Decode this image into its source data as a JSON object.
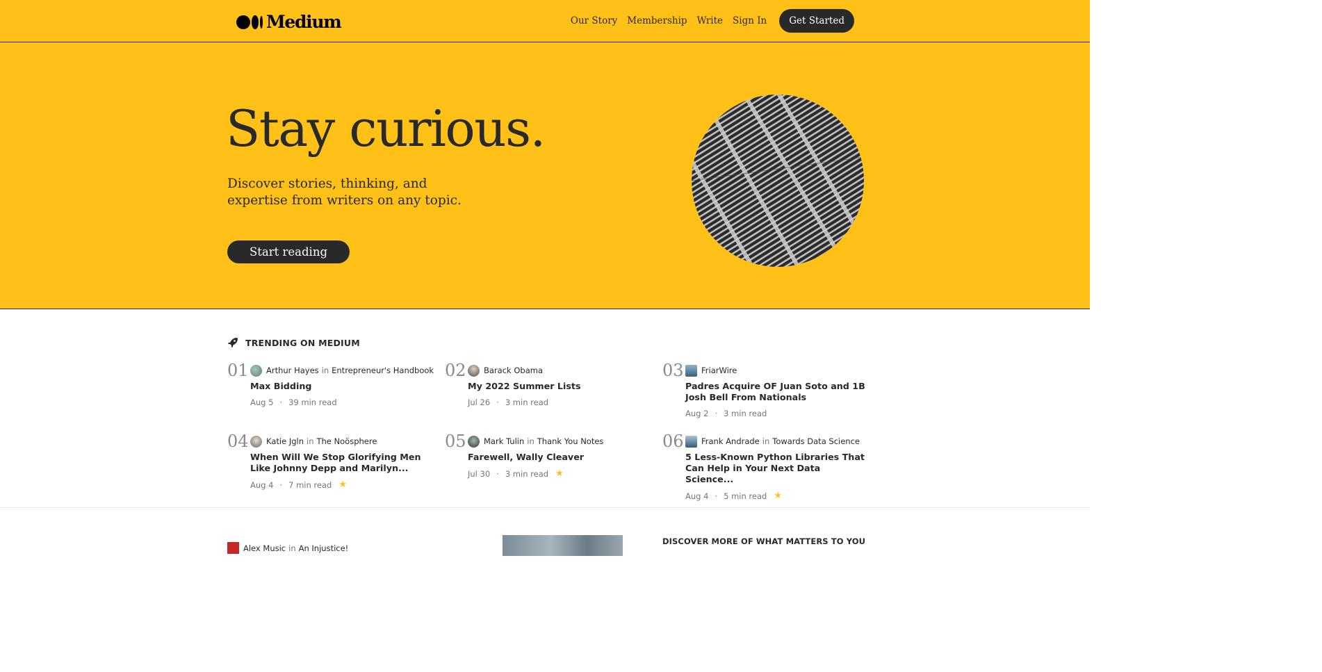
{
  "header": {
    "logo_text": "Medium",
    "nav": [
      "Our Story",
      "Membership",
      "Write",
      "Sign In"
    ],
    "cta_label": "Get Started"
  },
  "hero": {
    "title": "Stay curious.",
    "subtitle": "Discover stories, thinking, and expertise from writers on any topic.",
    "cta_label": "Start reading"
  },
  "trending": {
    "heading": "TRENDING ON MEDIUM",
    "in_word": "in",
    "items": [
      {
        "num": "01",
        "author": "Arthur Hayes",
        "publication": "Entrepreneur's Handbook",
        "title": "Max Bidding",
        "date": "Aug 5",
        "read": "39 min read",
        "starred": false
      },
      {
        "num": "02",
        "author": "Barack Obama",
        "publication": "",
        "title": "My 2022 Summer Lists",
        "date": "Jul 26",
        "read": "3 min read",
        "starred": false
      },
      {
        "num": "03",
        "author": "FriarWire",
        "publication": "",
        "title": "Padres Acquire OF Juan Soto and 1B Josh Bell From Nationals",
        "date": "Aug 2",
        "read": "3 min read",
        "starred": false
      },
      {
        "num": "04",
        "author": "Katie Jgln",
        "publication": "The Noösphere",
        "title": "When Will We Stop Glorifying Men Like Johnny Depp and Marilyn...",
        "date": "Aug 4",
        "read": "7 min read",
        "starred": true
      },
      {
        "num": "05",
        "author": "Mark Tulin",
        "publication": "Thank You Notes",
        "title": "Farewell, Wally Cleaver",
        "date": "Jul 30",
        "read": "3 min read",
        "starred": true
      },
      {
        "num": "06",
        "author": "Frank Andrade",
        "publication": "Towards Data Science",
        "title": "5 Less-Known Python Libraries That Can Help in Your Next Data Science...",
        "date": "Aug 4",
        "read": "5 min read",
        "starred": true
      }
    ]
  },
  "feed": {
    "author": "Alex Music",
    "publication": "An Injustice!",
    "in_word": "in"
  },
  "sidebar": {
    "heading": "DISCOVER MORE OF WHAT MATTERS TO YOU"
  },
  "colors": {
    "accent": "#FFC017",
    "dark": "#292929"
  }
}
